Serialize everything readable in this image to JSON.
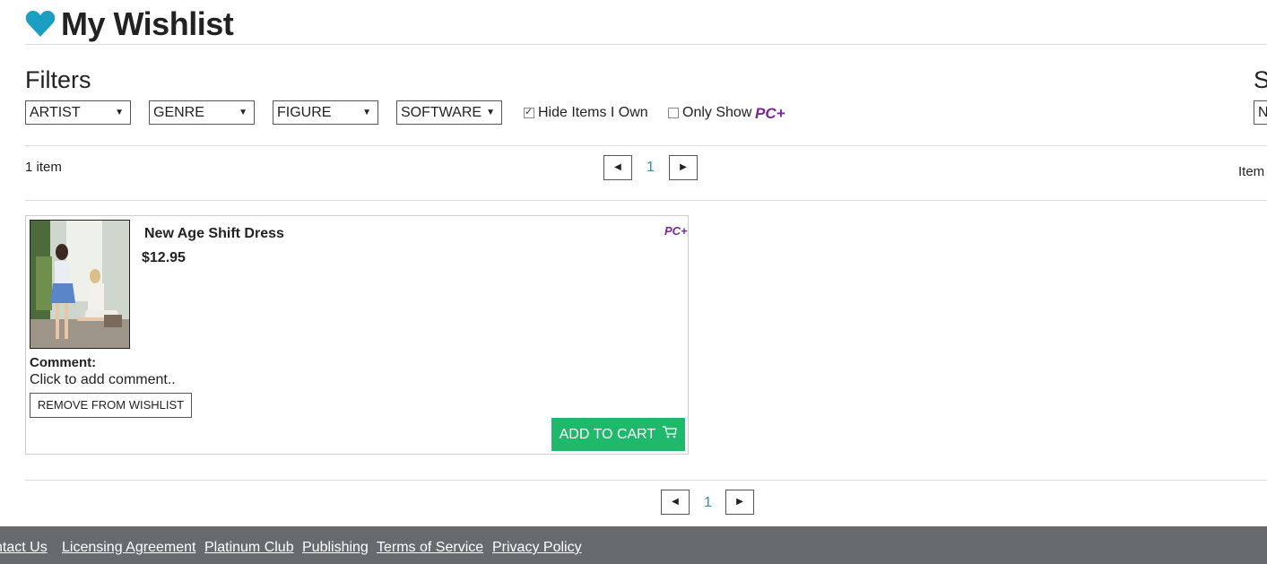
{
  "page": {
    "title": "My Wishlist",
    "heart_icon": "heart-icon",
    "accent_color": "#1a9fc2"
  },
  "filters": {
    "heading": "Filters",
    "selects": [
      {
        "label": "ARTIST"
      },
      {
        "label": "GENRE"
      },
      {
        "label": "FIGURE"
      },
      {
        "label": "SOFTWARE"
      }
    ],
    "hide_owned": {
      "label": "Hide Items I Own",
      "checked": true
    },
    "only_show": {
      "label": "Only Show",
      "checked": false,
      "badge": "PC+"
    }
  },
  "sort": {
    "heading": "S",
    "select_value": "N"
  },
  "results": {
    "count_label": "1 item",
    "current_page": "1",
    "items_per_page_label": "Item"
  },
  "items": [
    {
      "name": "New Age Shift Dress",
      "price": "$12.95",
      "badge": "PC+",
      "comment_label": "Comment:",
      "comment_placeholder": "Click to add comment..",
      "remove_label": "REMOVE FROM WISHLIST",
      "add_to_cart_label": "ADD TO CART",
      "cart_color": "#1fb96b"
    }
  ],
  "footer": {
    "links": [
      "ntact Us",
      "Licensing Agreement",
      "Platinum Club",
      "Publishing",
      "Terms of Service",
      "Privacy Policy"
    ],
    "background": "#676b6e"
  }
}
